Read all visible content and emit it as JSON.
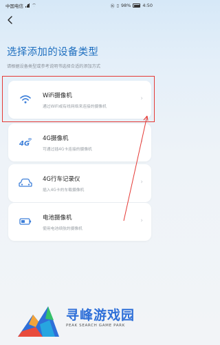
{
  "status_bar": {
    "carrier": "中国电信",
    "battery": "98%",
    "time": "4:50"
  },
  "header": {
    "title": "选择添加的设备类型",
    "subtitle": "请根据设备类型或参考说明书选择合适的添加方式"
  },
  "devices": [
    {
      "title": "WiFi摄像机",
      "desc": "通过WiFi或有线网络来连接的摄像机",
      "icon": "wifi-icon",
      "highlighted": true
    },
    {
      "title": "4G摄像机",
      "desc": "可通过插4G卡连接的摄像机",
      "icon": "4g-icon"
    },
    {
      "title": "4G行车记录仪",
      "desc": "插入4G卡的车载摄像机",
      "icon": "car-recorder-icon"
    },
    {
      "title": "电池摄像机",
      "desc": "使用电池续航的摄像机",
      "icon": "battery-icon"
    }
  ],
  "watermark": {
    "name": "寻峰游戏园",
    "tagline": "PEAK SEARCH GAME PARK"
  },
  "colors": {
    "accent": "#1f6fbf",
    "highlight": "#e53935",
    "icon_blue": "#3d7fd9"
  }
}
